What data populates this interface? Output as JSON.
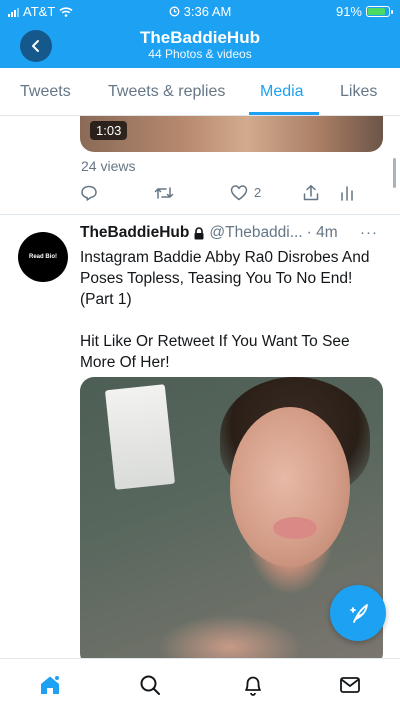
{
  "status_bar": {
    "carrier": "AT&T",
    "time": "3:36 AM",
    "battery": "91%",
    "battery_level": 0.91
  },
  "header": {
    "title": "TheBaddieHub",
    "subtitle": "44 Photos & videos",
    "back_icon": "chevron-left-icon"
  },
  "tabs": [
    {
      "label": "Tweets",
      "active": false
    },
    {
      "label": "Tweets & replies",
      "active": false
    },
    {
      "label": "Media",
      "active": true
    },
    {
      "label": "Likes",
      "active": false
    }
  ],
  "previous_tweet": {
    "video_duration": "1:03",
    "views": "24 views",
    "likes": "2"
  },
  "tweet": {
    "avatar_text": "Read Bio!",
    "name": "TheBaddieHub",
    "handle": "@Thebaddi...",
    "time": "· 4m",
    "more": "···",
    "text_1": "Instagram Baddie Abby Ra0 Disrobes And Poses Topless, Teasing You To No End! (Part 1)",
    "text_2": "Hit Like Or Retweet If You Want To See More Of Her!"
  },
  "colors": {
    "accent": "#1da1f2",
    "text_secondary": "#657786"
  },
  "bottom_nav": [
    {
      "icon": "home-icon",
      "active": true
    },
    {
      "icon": "search-icon",
      "active": false
    },
    {
      "icon": "bell-icon",
      "active": false
    },
    {
      "icon": "mail-icon",
      "active": false
    }
  ]
}
